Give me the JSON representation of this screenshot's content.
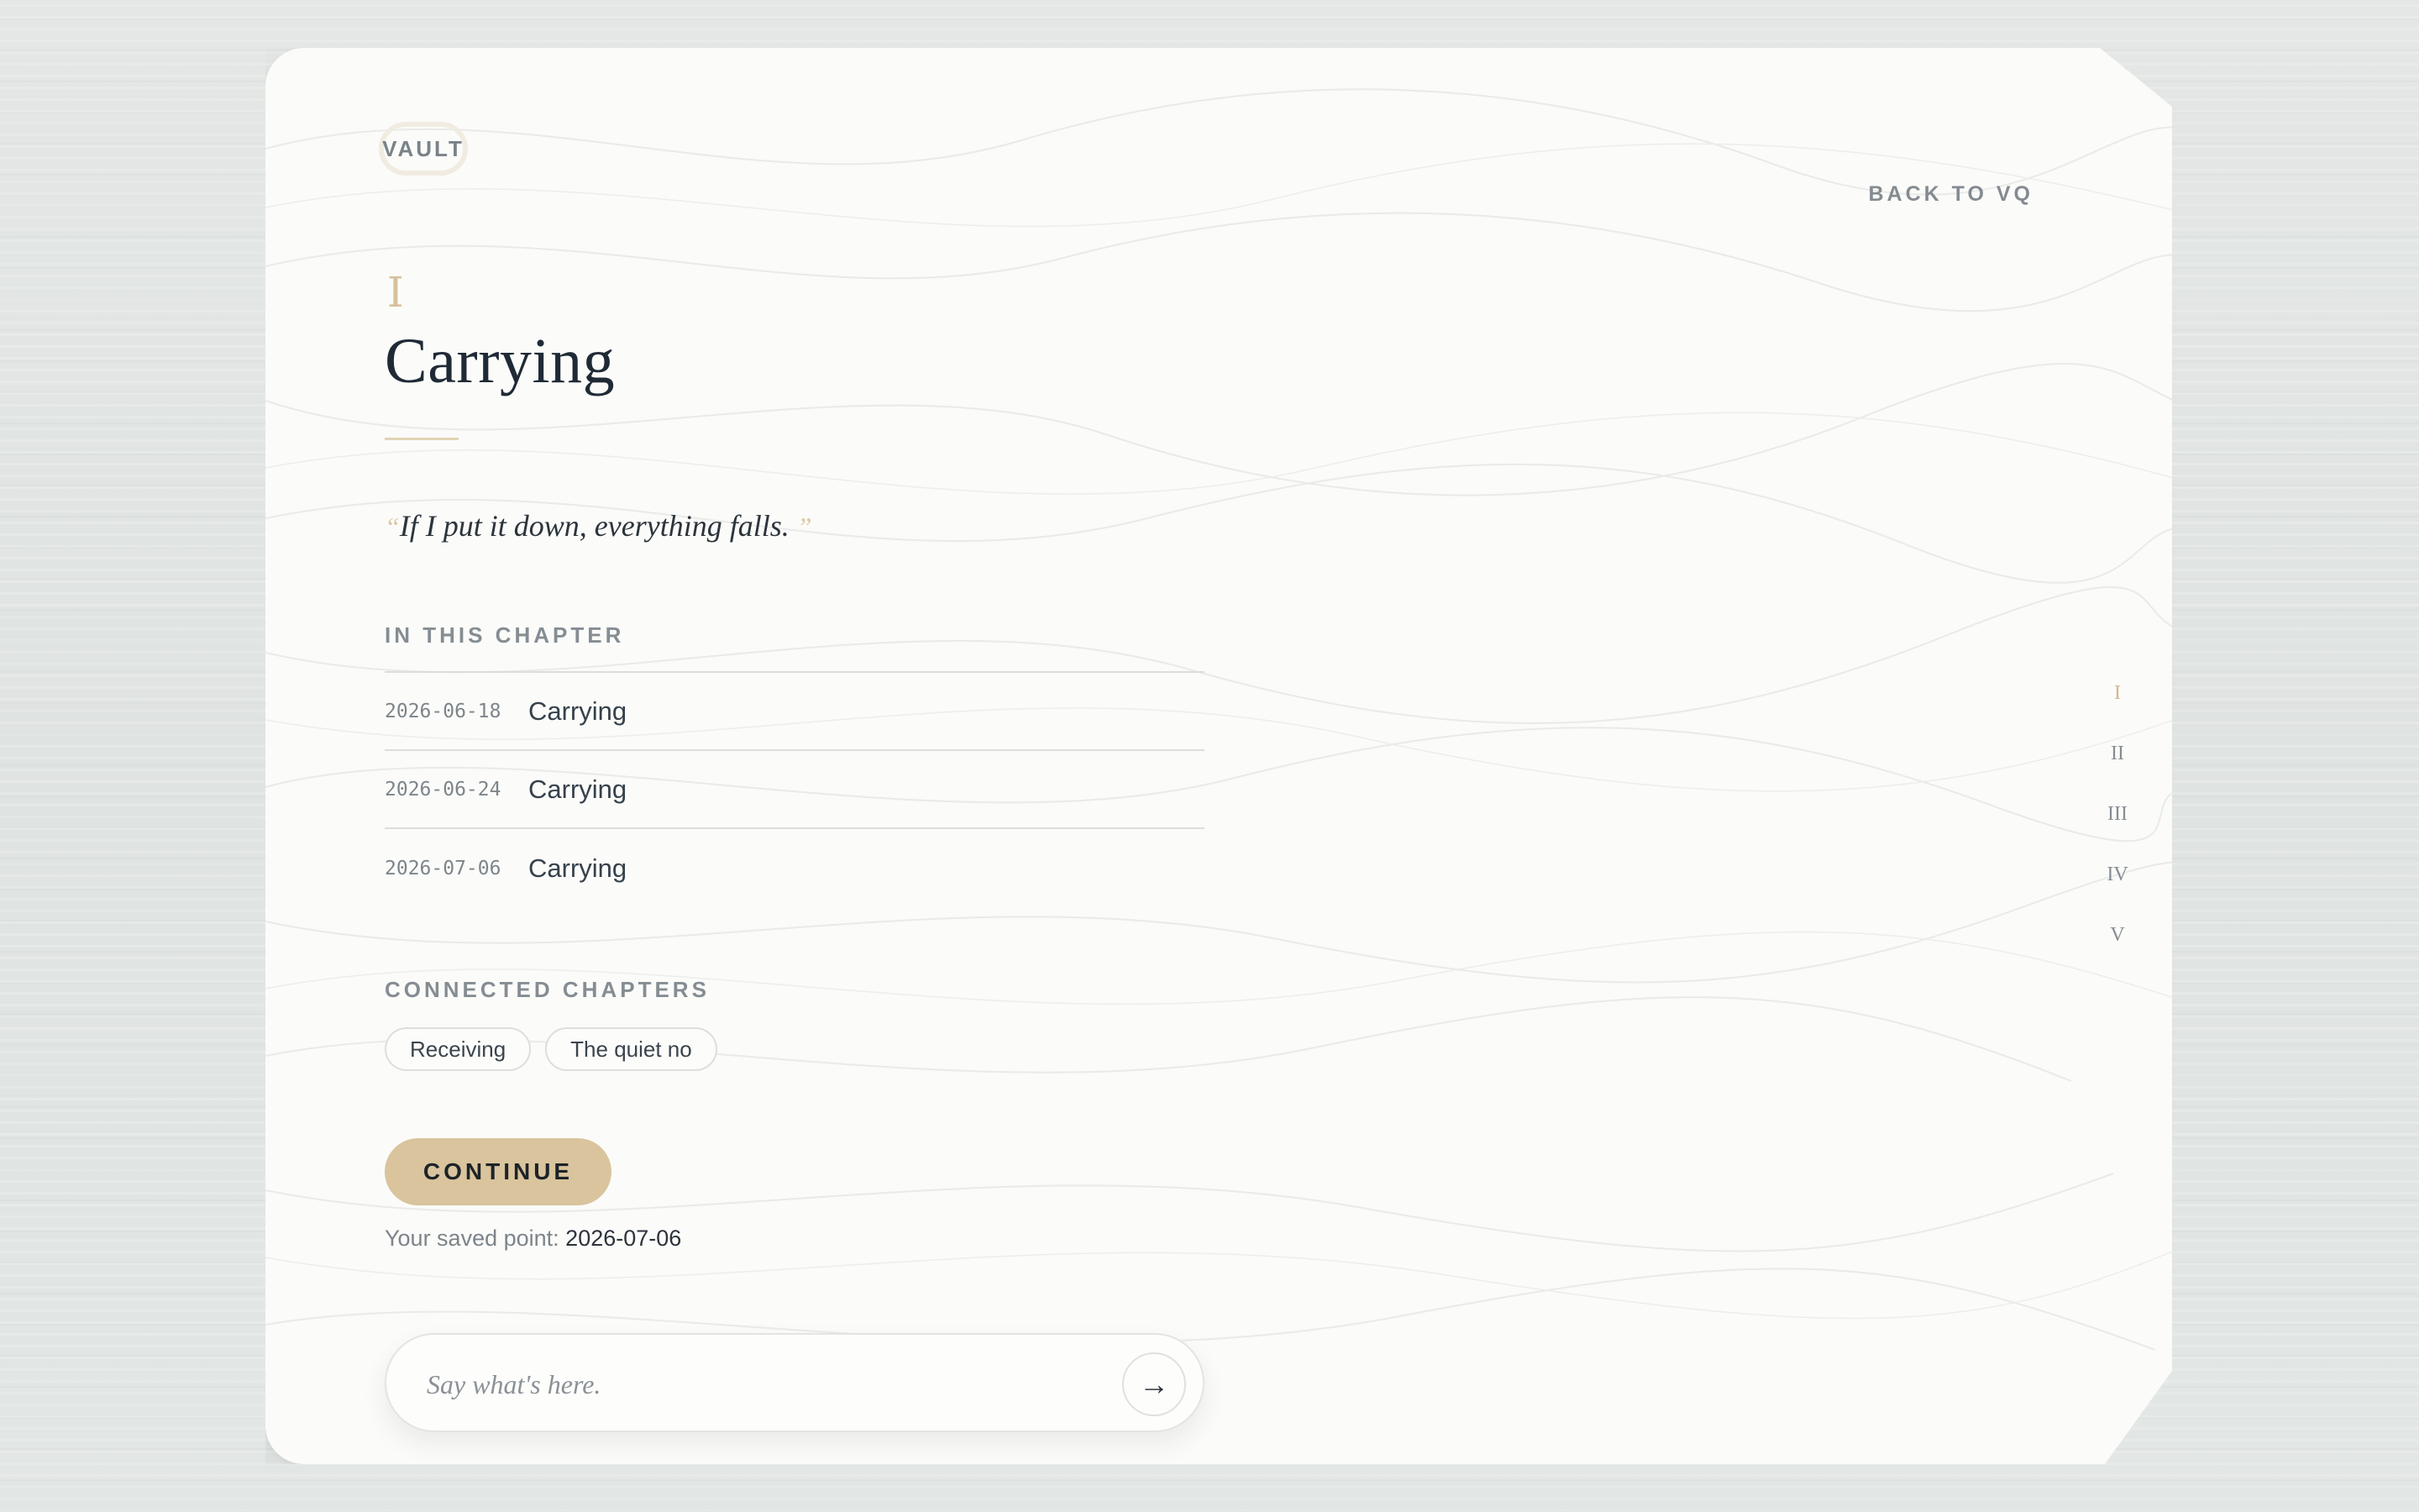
{
  "header": {
    "vault_label": "VAULT",
    "back_label": "BACK TO VQ"
  },
  "chapter": {
    "numeral": "I",
    "title": "Carrying",
    "quote": "If I put it down, everything falls.",
    "quote_open": "“",
    "quote_close": "”"
  },
  "in_this_chapter": {
    "label": "IN THIS CHAPTER",
    "entries": [
      {
        "date": "2026-06-18",
        "title": "Carrying"
      },
      {
        "date": "2026-06-24",
        "title": "Carrying"
      },
      {
        "date": "2026-07-06",
        "title": "Carrying"
      }
    ]
  },
  "connected": {
    "label": "CONNECTED CHAPTERS",
    "chips": [
      "Receiving",
      "The quiet no"
    ]
  },
  "continue": {
    "button_label": "CONTINUE",
    "saved_prefix": "Your saved point:",
    "saved_value": "2026-07-06"
  },
  "composer": {
    "placeholder": "Say what's here.",
    "send_glyph": "→",
    "send_icon": "arrow-right-icon"
  },
  "chapter_nav": {
    "items": [
      "I",
      "II",
      "III",
      "IV",
      "V"
    ],
    "active_index": 0
  },
  "colors": {
    "accent_gold": "#d9c49d",
    "card_background": "#fbfbf9",
    "title_ink": "#1f2a36"
  }
}
